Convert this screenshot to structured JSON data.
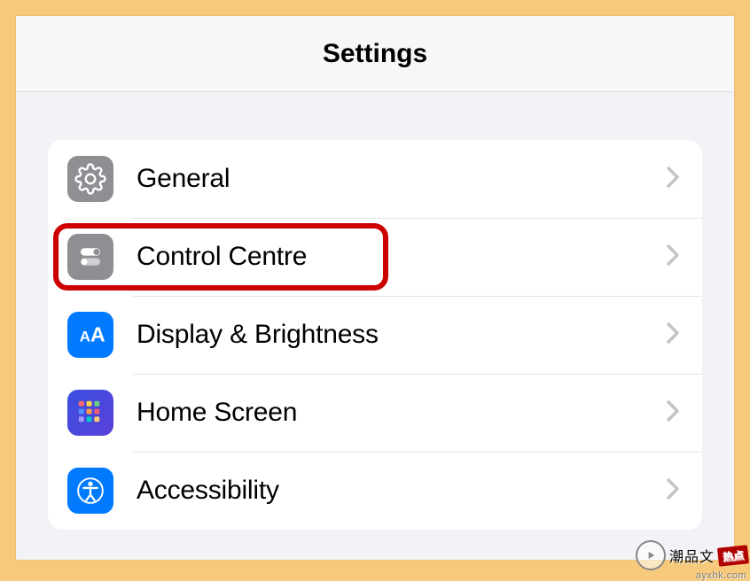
{
  "header": {
    "title": "Settings"
  },
  "items": [
    {
      "name": "general",
      "label": "General",
      "icon": "gear",
      "iconClass": "icon-general"
    },
    {
      "name": "control-centre",
      "label": "Control Centre",
      "icon": "toggles",
      "iconClass": "icon-control",
      "highlighted": true
    },
    {
      "name": "display",
      "label": "Display & Brightness",
      "icon": "aa",
      "iconClass": "icon-display"
    },
    {
      "name": "home-screen",
      "label": "Home Screen",
      "icon": "apps",
      "iconClass": "icon-home"
    },
    {
      "name": "accessibility",
      "label": "Accessibility",
      "icon": "access",
      "iconClass": "icon-access"
    }
  ],
  "watermark": {
    "main": "潮品文",
    "badge": "热点",
    "url": "ayxhk.com"
  }
}
